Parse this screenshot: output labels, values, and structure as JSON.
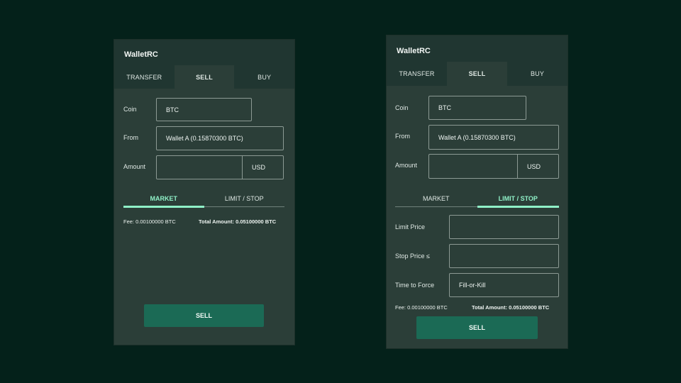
{
  "left_panel": {
    "title": "WalletRC",
    "tabs": [
      "TRANSFER",
      "SELL",
      "BUY"
    ],
    "active_tab": "SELL",
    "coin": {
      "label": "Coin",
      "value": "BTC"
    },
    "from": {
      "label": "From",
      "value": "Wallet A (0.15870300 BTC)"
    },
    "amount": {
      "label": "Amount",
      "value": "",
      "unit": "USD"
    },
    "order_tabs": [
      "MARKET",
      "LIMIT / STOP"
    ],
    "active_order_tab": "MARKET",
    "fee": "Fee: 0.00100000 BTC",
    "total": "Total Amount: 0.05100000 BTC",
    "sell_button": "SELL"
  },
  "right_panel": {
    "title": "WalletRC",
    "tabs": [
      "TRANSFER",
      "SELL",
      "BUY"
    ],
    "active_tab": "SELL",
    "coin": {
      "label": "Coin",
      "value": "BTC"
    },
    "from": {
      "label": "From",
      "value": "Wallet A (0.15870300 BTC)"
    },
    "amount": {
      "label": "Amount",
      "value": "",
      "unit": "USD"
    },
    "order_tabs": [
      "MARKET",
      "LIMIT / STOP"
    ],
    "active_order_tab": "LIMIT / STOP",
    "limit_price": {
      "label": "Limit Price",
      "value": ""
    },
    "stop_price": {
      "label": "Stop Price ≤",
      "value": ""
    },
    "time_to_force": {
      "label": "Time to Force",
      "value": "Fill-or-Kill"
    },
    "fee": "Fee: 0.00100000 BTC",
    "total": "Total Amount: 0.05100000 BTC",
    "sell_button": "SELL"
  },
  "colors": {
    "background": "#04211a",
    "panel": "#2b3e38",
    "header": "#203631",
    "accent": "#8ff0c7",
    "button": "#1b6a55"
  }
}
